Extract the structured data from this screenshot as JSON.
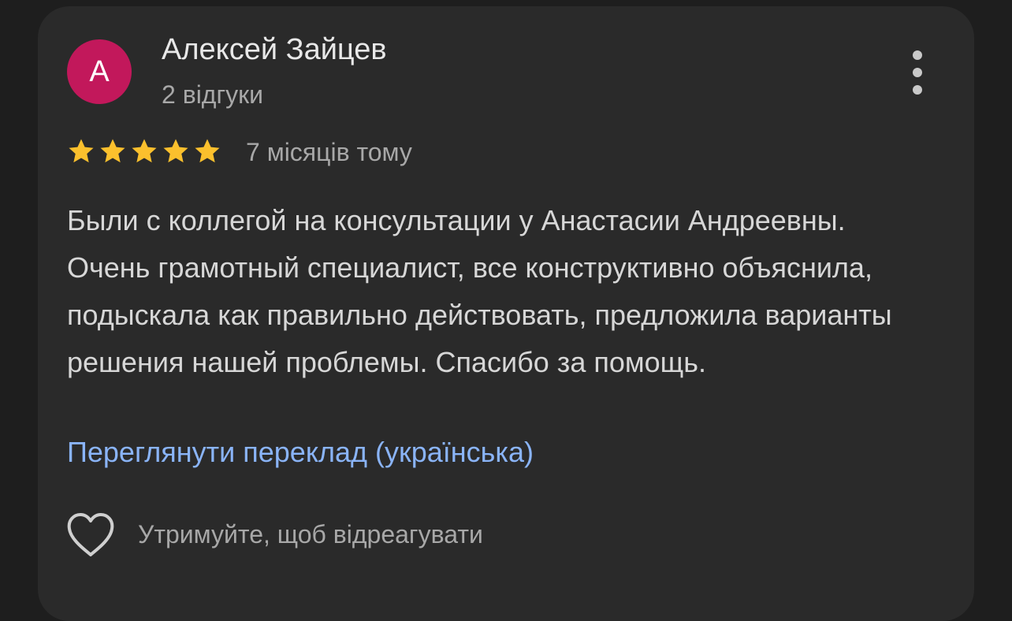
{
  "review": {
    "author_initial": "А",
    "author_name": "Алексей Зайцев",
    "author_reviews": "2 відгуки",
    "rating": 5,
    "rating_max": 5,
    "time": "7 місяців тому",
    "text": "Были с коллегой на консультации у Анастасии Андреевны. Очень грамотный специалист, все конструктивно объяснила, подыскала как правильно действовать, предложила варианты решения нашей проблемы. Спасибо за помощь.",
    "translate_link": "Переглянути переклад (українська)",
    "react_hint": "Утримуйте, щоб відреагувати"
  },
  "icons": {
    "more": "more-vert-icon",
    "star": "star-icon",
    "like": "heart-outline-icon"
  },
  "colors": {
    "background": "#1e1e1e",
    "card": "#2a2a2a",
    "avatar": "#c2185b",
    "star": "#fbc02d",
    "link": "#8ab4f8",
    "primary_text": "#e8e8e8",
    "secondary_text": "#a8a8a8"
  }
}
